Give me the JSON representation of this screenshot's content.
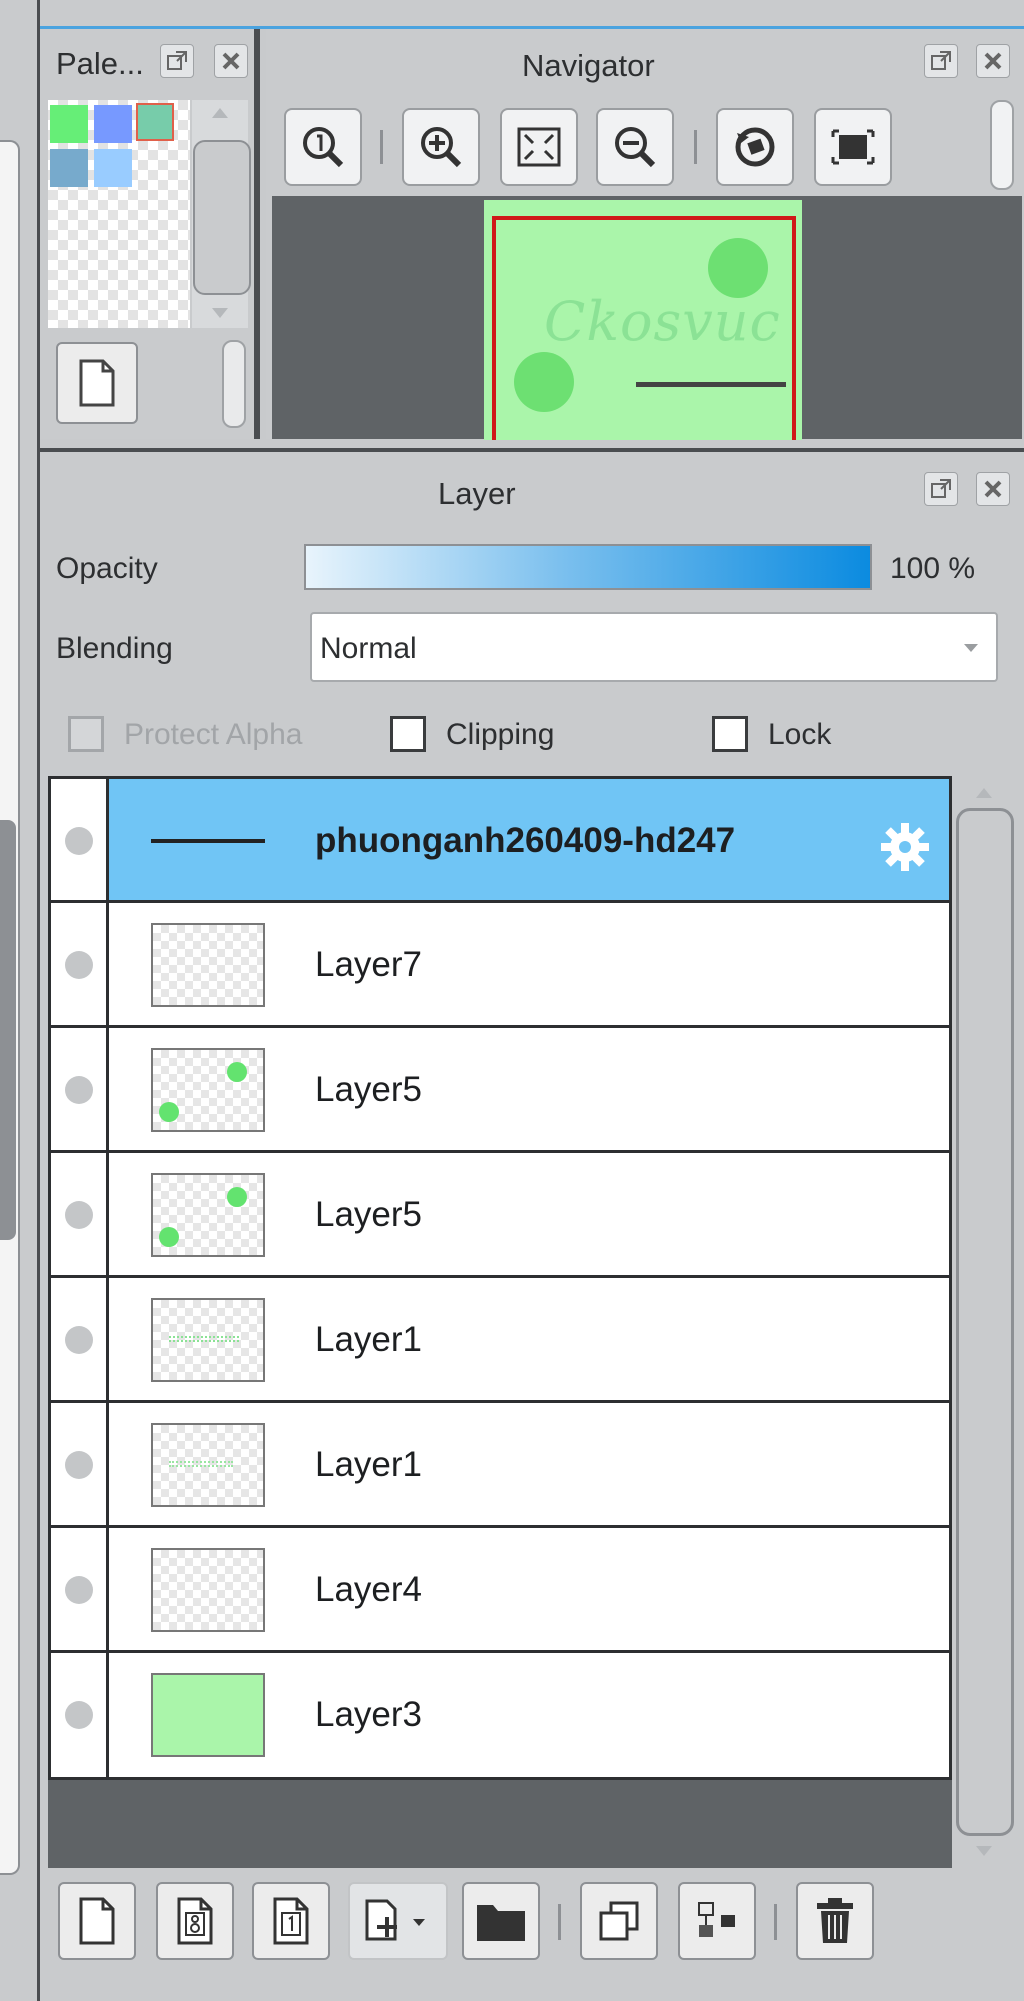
{
  "palette": {
    "title": "Pale...",
    "swatches": [
      "#66ee77",
      "#7799ff",
      "#77ccaa",
      "#77aacc",
      "#99ccff"
    ]
  },
  "navigator": {
    "title": "Navigator",
    "thumbnail_text": "Ckosvuc"
  },
  "layer_panel": {
    "title": "Layer",
    "opacity_label": "Opacity",
    "opacity_value": "100 %",
    "opacity_fraction": 1.0,
    "blending_label": "Blending",
    "blending_value": "Normal",
    "protect_alpha_label": "Protect Alpha",
    "clipping_label": "Clipping",
    "lock_label": "Lock",
    "layers": [
      {
        "name": "phuonganh260409-hd247",
        "selected": true
      },
      {
        "name": "Layer7"
      },
      {
        "name": "Layer5"
      },
      {
        "name": "Layer5"
      },
      {
        "name": "Layer1"
      },
      {
        "name": "Layer1"
      },
      {
        "name": "Layer4"
      },
      {
        "name": "Layer3"
      }
    ]
  },
  "colors": {
    "accent": "#4aa3df",
    "selected_row": "#70c5f5",
    "thumb_green": "#aaf5aa"
  }
}
